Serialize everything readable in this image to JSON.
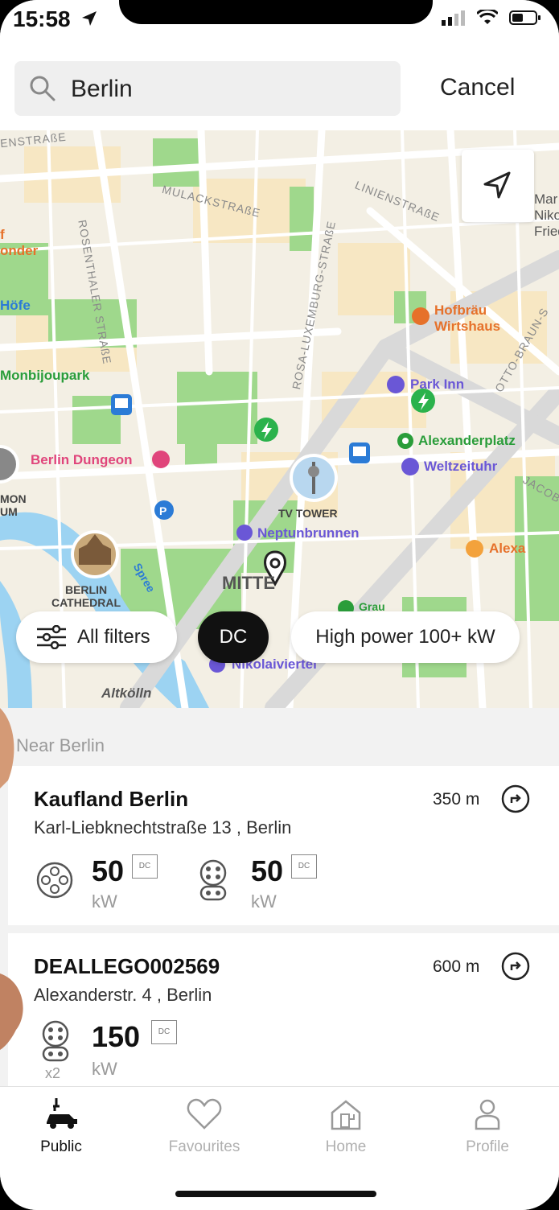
{
  "status_bar": {
    "time": "15:58"
  },
  "search": {
    "value": "Berlin",
    "cancel_label": "Cancel"
  },
  "map": {
    "labels": {
      "street1": "ENSTRAßE",
      "street2": "MULACKSTRAßE",
      "street3": "ROSENTHALER STRAßE",
      "street4": "LINIENSTRAßE",
      "street5": "ROSA-LUXEMBURG-STRAßE",
      "street6": "OTTO-BRAUN-S",
      "street7": "JACOB",
      "onder": "onder",
      "f": "f",
      "hofe": "Höfe",
      "monbijoupark": "Monbijoupark",
      "berlin_dungeon": "Berlin Dungeon",
      "mon_um": "MON\nUM",
      "tv_tower": "TV TOWER",
      "neptunbrunnen": "Neptunbrunnen",
      "berlin_cathedral": "BERLIN\nCATHEDRAL",
      "spree": "Spree",
      "mitte": "MITTE",
      "nikolaiviertel": "Nikolaiviertel",
      "altkolln": "Altkölln",
      "hofbrau": "Hofbräu\nWirtshaus",
      "park_inn": "Park Inn",
      "alexanderplatz": "Alexanderplatz",
      "weltzeituhr": "Weltzeituhr",
      "alexa": "Alexa",
      "marx": "Mar\nNiko\nFriedho",
      "grau": "Grau"
    },
    "filters": {
      "all_filters": "All filters",
      "dc": "DC",
      "high_power": "High power 100+ kW"
    }
  },
  "list": {
    "section_label": "Near Berlin",
    "stations": [
      {
        "name": "Kaufland Berlin",
        "address": "Karl-Liebknechtstraße 13 , Berlin",
        "distance": "350 m",
        "connectors": [
          {
            "power": "50",
            "type": "DC",
            "unit": "kW",
            "icon": "chademo-connector-icon"
          },
          {
            "power": "50",
            "type": "DC",
            "unit": "kW",
            "icon": "ccs-connector-icon"
          }
        ]
      },
      {
        "name": "DEALLEGO002569",
        "address": "Alexanderstr. 4  , Berlin",
        "distance": "600 m",
        "connectors": [
          {
            "power": "150",
            "type": "DC",
            "unit": "kW",
            "icon": "ccs-connector-icon",
            "count": "x2"
          }
        ]
      }
    ]
  },
  "tabs": [
    {
      "label": "Public",
      "icon": "charging-car-icon",
      "active": true
    },
    {
      "label": "Favourites",
      "icon": "heart-icon",
      "active": false
    },
    {
      "label": "Home",
      "icon": "home-charger-icon",
      "active": false
    },
    {
      "label": "Profile",
      "icon": "person-icon",
      "active": false
    }
  ],
  "colors": {
    "map_bg": "#f2efe6",
    "park": "#8fd07c",
    "road": "#ffffff",
    "chip_active": "#111111",
    "poi_purple": "#6a57d6"
  }
}
